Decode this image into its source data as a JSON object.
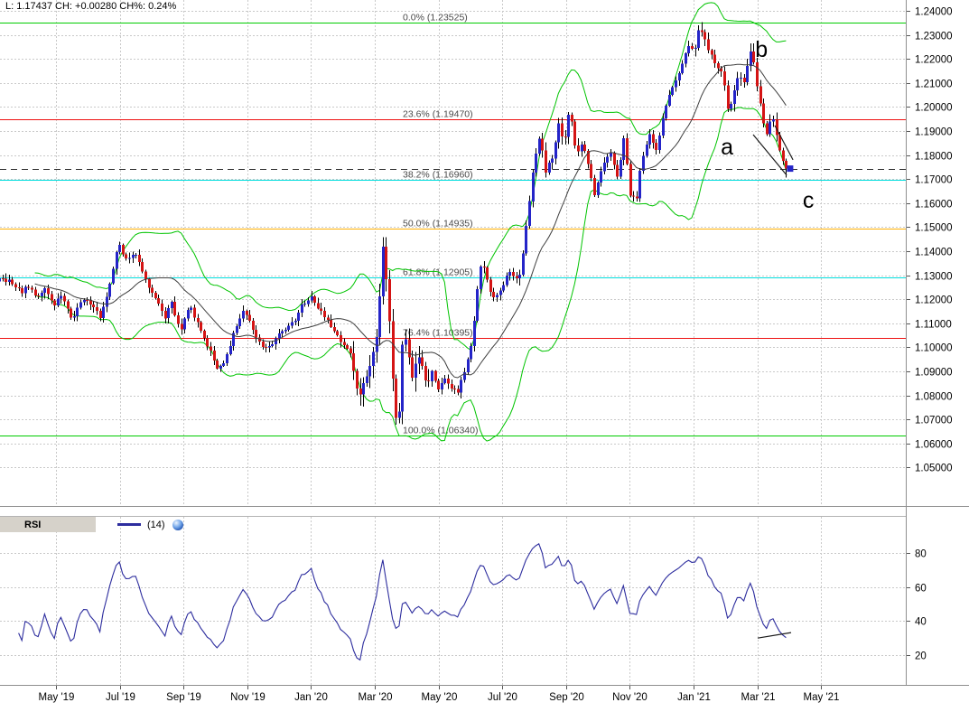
{
  "quote_bar": {
    "text": "L: 1.17437 CH: +0.00280 CH%: 0.24%"
  },
  "rsi_header": {
    "title": "RSI",
    "param": "(14)",
    "icon": "globe-icon"
  },
  "current_price": {
    "value": 1.17437
  },
  "colors": {
    "candle_up": "#2424c8",
    "candle_down": "#d41414",
    "wick": "#000000",
    "bollinger": "#00c400",
    "sma": "#3f3f3f",
    "rsi_line": "#2d2d9e",
    "grid": "#c9c9c9",
    "axis_line": "#8f8f8f",
    "fib_green": "#00cc00",
    "fib_red": "#ee1111",
    "fib_cyan": "#00dddd",
    "fib_gold": "#ffaf00",
    "annotation": "#1a1a1a"
  },
  "price_axis": {
    "ticks": [
      "1.24000",
      "1.23000",
      "1.22000",
      "1.21000",
      "1.20000",
      "1.19000",
      "1.18000",
      "1.17000",
      "1.16000",
      "1.15000",
      "1.14000",
      "1.13000",
      "1.12000",
      "1.11000",
      "1.10000",
      "1.09000",
      "1.08000",
      "1.07000",
      "1.06000",
      "1.05000"
    ]
  },
  "rsi_axis": {
    "ticks": [
      "80",
      "60",
      "40",
      "20"
    ]
  },
  "time_axis": {
    "labels": [
      {
        "text": "May '19",
        "t": 0
      },
      {
        "text": "Jul '19",
        "t": 2
      },
      {
        "text": "Sep '19",
        "t": 4
      },
      {
        "text": "Nov '19",
        "t": 6
      },
      {
        "text": "Jan '20",
        "t": 8
      },
      {
        "text": "Mar '20",
        "t": 10
      },
      {
        "text": "May '20",
        "t": 12
      },
      {
        "text": "Jul '20",
        "t": 14
      },
      {
        "text": "Sep '20",
        "t": 16
      },
      {
        "text": "Nov '20",
        "t": 18
      },
      {
        "text": "Jan '21",
        "t": 20
      },
      {
        "text": "Mar '21",
        "t": 22
      },
      {
        "text": "May '21",
        "t": 24
      }
    ]
  },
  "fib_levels": [
    {
      "text": "0.0% (1.23525)",
      "price": 1.23525,
      "color": "#00cc00"
    },
    {
      "text": "23.6% (1.19470)",
      "price": 1.1947,
      "color": "#ee1111"
    },
    {
      "text": "38.2% (1.16960)",
      "price": 1.1696,
      "color": "#00dddd"
    },
    {
      "text": "50.0% (1.14935)",
      "price": 1.14935,
      "color": "#ffaf00"
    },
    {
      "text": "61.8% (1.12905)",
      "price": 1.12905,
      "color": "#00dddd"
    },
    {
      "text": "76.4% (1.10395)",
      "price": 1.10395,
      "color": "#ee1111"
    },
    {
      "text": "100.0% (1.06340)",
      "price": 1.0634,
      "color": "#00cc00"
    }
  ],
  "wave_labels": [
    {
      "text": "a",
      "t": 21.05,
      "price": 1.1832
    },
    {
      "text": "b",
      "t": 22.13,
      "price": 1.2238
    },
    {
      "text": "c",
      "t": 23.6,
      "price": 1.161
    }
  ],
  "trendlines": {
    "price": [
      {
        "t1": 21.87,
        "p1": 1.1885,
        "t2": 22.92,
        "p2": 1.1716
      },
      {
        "t1": 22.55,
        "p1": 1.1923,
        "t2": 23.12,
        "p2": 1.178
      }
    ],
    "rsi": [
      {
        "t1": 22.01,
        "v1": 30.0,
        "t2": 23.06,
        "v2": 33.2
      }
    ]
  },
  "chart_data": {
    "type": "candlestick",
    "title": "",
    "x_unit": "months since 2019-05-01",
    "ylim": [
      1.04,
      1.245
    ],
    "rsi_ylim": [
      0,
      100
    ],
    "legend_position": "none",
    "grid": true,
    "last": {
      "price": 1.17437,
      "change": "+0.00280",
      "change_pct": "0.24%"
    },
    "indicators": {
      "bollinger": {
        "window": 20,
        "mult": 2
      },
      "sma": {
        "window": 20
      },
      "rsi": {
        "window": 14,
        "ticks": [
          20,
          40,
          60,
          80
        ]
      }
    },
    "price_path": [
      [
        -2.6,
        1.13
      ],
      [
        -2.3,
        1.128
      ],
      [
        -2.0,
        1.1255
      ],
      [
        -1.7,
        1.129
      ],
      [
        -1.4,
        1.127
      ],
      [
        -1.1,
        1.123
      ],
      [
        -0.85,
        1.126
      ],
      [
        -0.6,
        1.12
      ],
      [
        -0.35,
        1.1245
      ],
      [
        -0.1,
        1.1175
      ],
      [
        0.15,
        1.1215
      ],
      [
        0.5,
        1.1115
      ],
      [
        0.8,
        1.1205
      ],
      [
        1.1,
        1.1175
      ],
      [
        1.4,
        1.112
      ],
      [
        1.7,
        1.127
      ],
      [
        1.95,
        1.144
      ],
      [
        2.2,
        1.136
      ],
      [
        2.5,
        1.139
      ],
      [
        2.8,
        1.1285
      ],
      [
        3.1,
        1.1205
      ],
      [
        3.4,
        1.112
      ],
      [
        3.6,
        1.12
      ],
      [
        3.9,
        1.106
      ],
      [
        4.2,
        1.1175
      ],
      [
        4.5,
        1.108
      ],
      [
        4.8,
        1.099
      ],
      [
        5.1,
        1.0905
      ],
      [
        5.35,
        1.096
      ],
      [
        5.6,
        1.108
      ],
      [
        5.9,
        1.116
      ],
      [
        6.2,
        1.106
      ],
      [
        6.5,
        1.1005
      ],
      [
        6.8,
        1.102
      ],
      [
        7.1,
        1.1075
      ],
      [
        7.4,
        1.1095
      ],
      [
        7.7,
        1.117
      ],
      [
        8.0,
        1.1215
      ],
      [
        8.3,
        1.115
      ],
      [
        8.6,
        1.109
      ],
      [
        8.9,
        1.103
      ],
      [
        9.2,
        1.099
      ],
      [
        9.5,
        1.08
      ],
      [
        9.7,
        1.0855
      ],
      [
        9.9,
        1.096
      ],
      [
        10.1,
        1.11
      ],
      [
        10.27,
        1.145
      ],
      [
        10.45,
        1.11
      ],
      [
        10.6,
        1.075
      ],
      [
        10.73,
        1.064
      ],
      [
        10.9,
        1.11
      ],
      [
        11.05,
        1.095
      ],
      [
        11.2,
        1.087
      ],
      [
        11.4,
        1.099
      ],
      [
        11.6,
        1.083
      ],
      [
        11.8,
        1.09
      ],
      [
        12.0,
        1.082
      ],
      [
        12.2,
        1.088
      ],
      [
        12.4,
        1.083
      ],
      [
        12.6,
        1.082
      ],
      [
        12.8,
        1.09
      ],
      [
        13.0,
        1.099
      ],
      [
        13.2,
        1.123
      ],
      [
        13.35,
        1.138
      ],
      [
        13.55,
        1.125
      ],
      [
        13.75,
        1.12
      ],
      [
        13.95,
        1.125
      ],
      [
        14.2,
        1.131
      ],
      [
        14.5,
        1.128
      ],
      [
        14.75,
        1.15
      ],
      [
        15.0,
        1.178
      ],
      [
        15.2,
        1.188
      ],
      [
        15.35,
        1.174
      ],
      [
        15.55,
        1.178
      ],
      [
        15.75,
        1.193
      ],
      [
        15.95,
        1.185
      ],
      [
        16.1,
        1.199
      ],
      [
        16.3,
        1.181
      ],
      [
        16.5,
        1.185
      ],
      [
        16.7,
        1.175
      ],
      [
        16.9,
        1.163
      ],
      [
        17.1,
        1.174
      ],
      [
        17.35,
        1.182
      ],
      [
        17.6,
        1.171
      ],
      [
        17.8,
        1.187
      ],
      [
        18.0,
        1.164
      ],
      [
        18.2,
        1.162
      ],
      [
        18.35,
        1.177
      ],
      [
        18.6,
        1.189
      ],
      [
        18.8,
        1.181
      ],
      [
        19.05,
        1.196
      ],
      [
        19.3,
        1.208
      ],
      [
        19.55,
        1.215
      ],
      [
        19.8,
        1.225
      ],
      [
        20.0,
        1.222
      ],
      [
        20.2,
        1.2345
      ],
      [
        20.45,
        1.225
      ],
      [
        20.7,
        1.216
      ],
      [
        20.9,
        1.213
      ],
      [
        21.1,
        1.198
      ],
      [
        21.35,
        1.212
      ],
      [
        21.55,
        1.21
      ],
      [
        21.8,
        1.224
      ],
      [
        22.0,
        1.208
      ],
      [
        22.15,
        1.194
      ],
      [
        22.3,
        1.187
      ],
      [
        22.45,
        1.197
      ],
      [
        22.6,
        1.187
      ],
      [
        22.75,
        1.179
      ],
      [
        22.9,
        1.17437
      ]
    ]
  }
}
